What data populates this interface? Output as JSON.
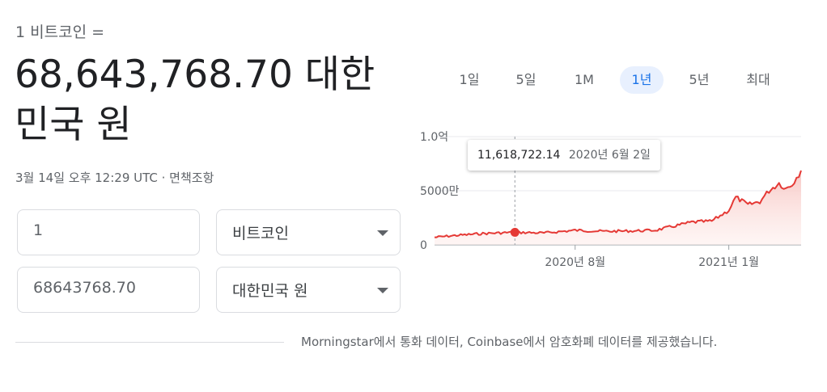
{
  "header": {
    "subtitle": "1 비트코인 =",
    "main_value": "68,643,768.70 대한민국 원",
    "timestamp": "3월 14일 오후 12:29 UTC · 면책조항"
  },
  "converter": {
    "amount_from": "1",
    "currency_from": "비트코인",
    "amount_to": "68643768.70",
    "currency_to": "대한민국 원"
  },
  "range_tabs": {
    "items": [
      "1일",
      "5일",
      "1M",
      "1년",
      "5년",
      "최대"
    ],
    "active": "1년"
  },
  "tooltip": {
    "value": "11,618,722.14",
    "date": "2020년 6월 2일"
  },
  "chart_data": {
    "type": "area",
    "y_tick_labels": [
      "0",
      "5000만",
      "1.0억"
    ],
    "x_tick_labels": [
      "2020년 8월",
      "2021년 1월"
    ],
    "ylim": [
      0,
      100000000
    ],
    "series": [
      {
        "x": [
          "2020-03-14",
          "2020-04-01",
          "2020-05-01",
          "2020-06-02",
          "2020-07-01",
          "2020-08-01",
          "2020-09-01",
          "2020-10-01",
          "2020-10-20",
          "2020-11-01",
          "2020-11-25",
          "2020-12-15",
          "2021-01-01",
          "2021-01-08",
          "2021-01-20",
          "2021-02-01",
          "2021-02-10",
          "2021-02-20",
          "2021-02-27",
          "2021-03-05",
          "2021-03-14"
        ],
        "values": [
          7000000,
          8500000,
          10500000,
          11618722,
          11000000,
          13500000,
          12500000,
          13000000,
          13500000,
          16000000,
          21000000,
          22000000,
          32000000,
          44000000,
          37000000,
          40000000,
          50000000,
          57000000,
          52000000,
          56000000,
          68643768
        ]
      }
    ],
    "highlight": {
      "x": "2020-06-02",
      "value": 11618722.14
    },
    "colors": {
      "line": "#e53935",
      "fill": "#fdecea"
    }
  },
  "footer": {
    "source": "Morningstar에서 통화 데이터, Coinbase에서 암호화폐 데이터를 제공했습니다."
  }
}
